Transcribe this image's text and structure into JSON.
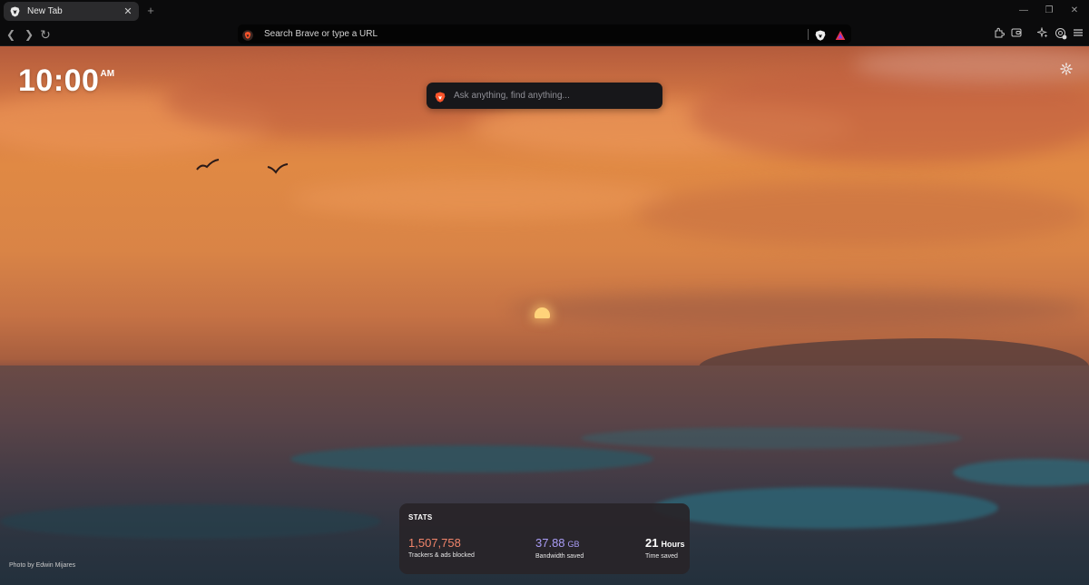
{
  "tab": {
    "title": "New Tab",
    "close_glyph": "✕",
    "favicon": "brave-lion-icon"
  },
  "new_tab_glyph": "+",
  "window_controls": {
    "minimize": "—",
    "restore": "❐",
    "close": "✕"
  },
  "toolbar": {
    "back": "❮",
    "forward": "❯",
    "reload": "↻",
    "url_placeholder": "Search Brave or type a URL"
  },
  "clock": {
    "time": "10:00",
    "ampm": "AM"
  },
  "search": {
    "placeholder": "Ask anything, find anything..."
  },
  "stats": {
    "title": "STATS",
    "trackers": {
      "value": "1,507,758",
      "label": "Trackers & ads blocked",
      "color": "#f0846a"
    },
    "bandwidth": {
      "value": "37.88",
      "unit": "GB",
      "label": "Bandwidth saved",
      "color": "#a99cf5"
    },
    "time": {
      "value": "21",
      "unit": "Hours",
      "label": "Time saved",
      "color": "#ffffff"
    }
  },
  "photo_credit": "Photo by Edwin Mijares",
  "colors": {
    "accent_brave": "#fb542b",
    "rewards": "#e6344a"
  }
}
